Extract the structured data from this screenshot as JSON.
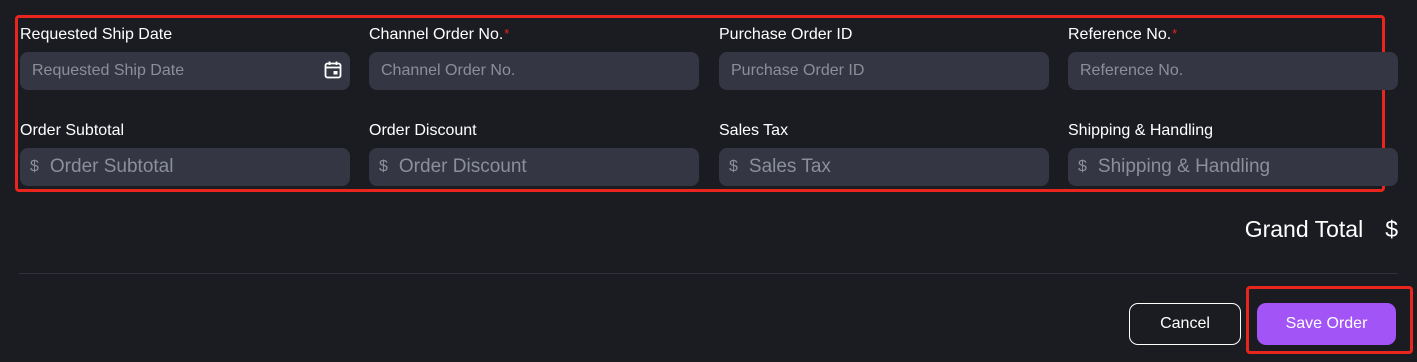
{
  "form": {
    "row1": [
      {
        "label": "Requested Ship Date",
        "required": "",
        "placeholder": "Requested Ship Date",
        "icon": "calendar-icon"
      },
      {
        "label": "Channel Order No.",
        "required": "*",
        "placeholder": "Channel Order No."
      },
      {
        "label": "Purchase Order ID",
        "required": "",
        "placeholder": "Purchase Order ID"
      },
      {
        "label": "Reference No.",
        "required": "*",
        "placeholder": "Reference No."
      }
    ],
    "row2": [
      {
        "label": "Order Subtotal",
        "currency": "$",
        "placeholder": "Order Subtotal"
      },
      {
        "label": "Order Discount",
        "currency": "$",
        "placeholder": "Order Discount"
      },
      {
        "label": "Sales Tax",
        "currency": "$",
        "placeholder": "Sales Tax"
      },
      {
        "label": "Shipping & Handling",
        "currency": "$",
        "placeholder": "Shipping & Handling"
      }
    ]
  },
  "summary": {
    "grand_total_label": "Grand Total",
    "grand_total_value": "$"
  },
  "actions": {
    "cancel_label": "Cancel",
    "save_label": "Save Order"
  },
  "colors": {
    "background": "#1b1c22",
    "input_bg": "#343743",
    "accent": "#a354f6",
    "highlight": "#e8261e",
    "required": "#e8261e"
  }
}
